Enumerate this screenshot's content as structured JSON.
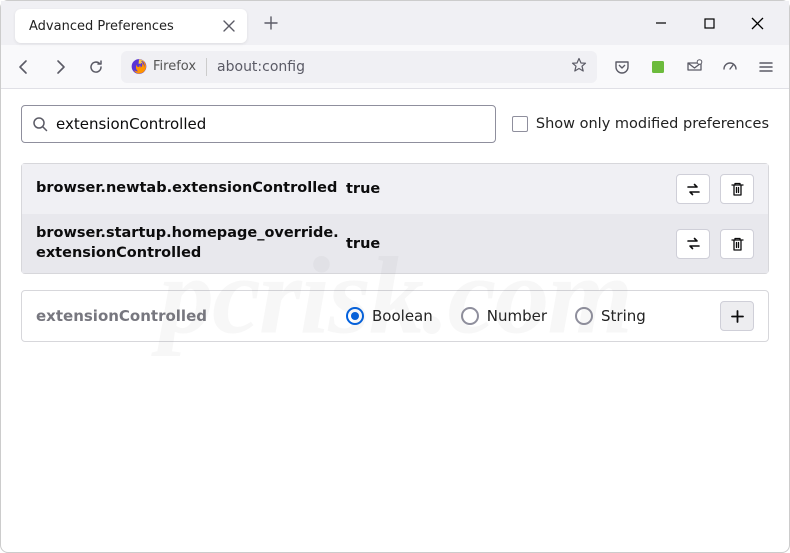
{
  "tab": {
    "title": "Advanced Preferences"
  },
  "addressbar": {
    "brand": "Firefox",
    "url": "about:config"
  },
  "search": {
    "value": "extensionControlled",
    "checkbox_label": "Show only modified preferences"
  },
  "prefs": [
    {
      "name": "browser.newtab.extensionControlled",
      "value": "true"
    },
    {
      "name": "browser.startup.homepage_override.extensionControlled",
      "value": "true"
    }
  ],
  "add": {
    "name": "extensionControlled",
    "types": [
      "Boolean",
      "Number",
      "String"
    ],
    "selected": "Boolean"
  },
  "watermark": "pcrisk.com"
}
